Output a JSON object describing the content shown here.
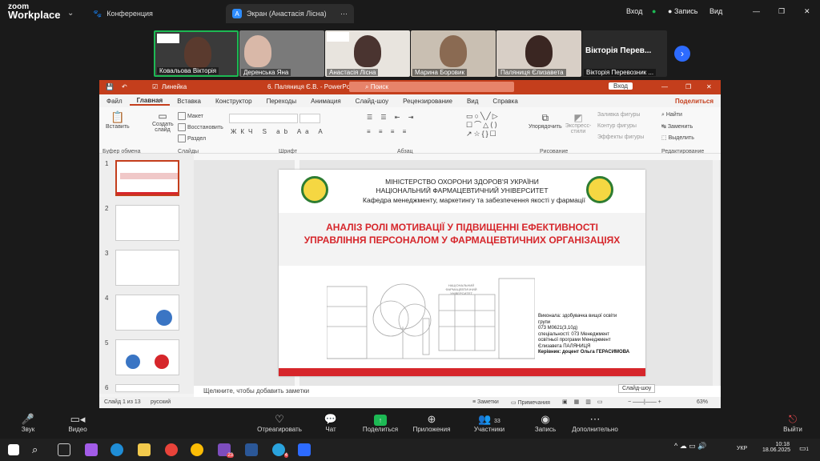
{
  "app": {
    "brand_line1": "zoom",
    "brand_line2": "Workplace"
  },
  "tabs": [
    {
      "label": "Конференция"
    },
    {
      "label": "Экран (Анастасія Лісна)",
      "icon_letter": "A"
    }
  ],
  "top_actions": {
    "login": "Вход",
    "record": "Запись",
    "view": "Вид"
  },
  "participants": [
    {
      "name": "Ковальова Вікторія"
    },
    {
      "name": "Деренська Яна"
    },
    {
      "name": "Анастасія Лісна"
    },
    {
      "name": "Марина Боровик"
    },
    {
      "name": "Паляниця Єлизавета"
    },
    {
      "name": "Вікторія Перевозник ...",
      "big_label": "Вікторія Перев..."
    }
  ],
  "ppt": {
    "doc_title": "6. Паляниця Є.В. - PowerPoint",
    "quick_label": "Линейка",
    "search_placeholder": "Поиск",
    "login": "Вход",
    "share": "Поделиться",
    "menu": [
      "Файл",
      "Главная",
      "Вставка",
      "Конструктор",
      "Переходы",
      "Анимация",
      "Слайд-шоу",
      "Рецензирование",
      "Вид",
      "Справка"
    ],
    "ribbon": {
      "paste": "Вставить",
      "new_slide": "Создать слайд",
      "layout": "Макет",
      "reset": "Восстановить",
      "section": "Раздел",
      "arrange": "Упорядочить",
      "styles": "Экспресс-стили",
      "fill": "Заливка фигуры",
      "outline": "Контур фигуры",
      "effects": "Эффекты фигуры",
      "find": "Найти",
      "replace": "Заменить",
      "select": "Выделить",
      "groups": [
        "Буфер обмена",
        "Слайды",
        "Шрифт",
        "Абзац",
        "Рисование",
        "Редактирование"
      ]
    },
    "slide_numbers": [
      "1",
      "2",
      "3",
      "4",
      "5",
      "6"
    ],
    "slide": {
      "ministry": "МІНІСТЕРСТВО ОХОРОНИ ЗДОРОВ'Я УКРАЇНИ",
      "university": "НАЦІОНАЛЬНИЙ ФАРМАЦЕВТИЧНИЙ УНІВЕРСИТЕТ",
      "department": "Кафедра менеджменту, маркетингу та забезпечення якості у фармації",
      "title": "АНАЛІЗ РОЛІ МОТИВАЦІЇ У ПІДВИЩЕННІ ЕФЕКТИВНОСТІ УПРАВЛІННЯ ПЕРСОНАЛОМ У ФАРМАЦЕВТИЧНИХ ОРГАНІЗАЦІЯХ",
      "credits": [
        "Виконала: здобувачка вищої освіти",
        "групи",
        "073 М0621(3,10д)",
        "спеціальності: 073 Менеджмент",
        "освітньої програми Менеджмент",
        "Єлизавета ПАЛЯНИЦЯ",
        "Керівник: доцент Ольга ГЕРАСИМОВА"
      ],
      "building_sign": "НАЦІОНАЛЬНИЙ ФАРМАЦЕВТИЧНИЙ УНІВЕРСИТЕТ"
    },
    "notes_placeholder": "Щелкните, чтобы добавить заметки",
    "status": {
      "slide_info": "Слайд 1 из 13",
      "language": "русский",
      "notes": "Заметки",
      "comments": "Примечания",
      "zoom": "63%",
      "slideshow_tip": "Слайд-шоу"
    }
  },
  "toolbar": [
    {
      "label": "Звук",
      "icon": "mic-muted-icon"
    },
    {
      "label": "Видео",
      "icon": "video-icon"
    },
    {
      "label": "Отреагировать",
      "icon": "heart-icon"
    },
    {
      "label": "Чат",
      "icon": "chat-icon"
    },
    {
      "label": "Поделиться",
      "icon": "share-icon"
    },
    {
      "label": "Приложения",
      "icon": "apps-icon"
    },
    {
      "label": "Участники",
      "icon": "participants-icon",
      "count": "33"
    },
    {
      "label": "Запись",
      "icon": "record-icon"
    },
    {
      "label": "Дополнительно",
      "icon": "more-icon"
    },
    {
      "label": "Выйти",
      "icon": "leave-icon"
    }
  ],
  "taskbar": {
    "time": "10:18",
    "date": "18.06.2025",
    "lang": "УКР",
    "badge_viber": "23",
    "badge_chat": "4",
    "notif": "1"
  },
  "colors": {
    "ppt_red": "#c43e1c",
    "slide_red": "#d6262b",
    "zoom_blue": "#2d6bff",
    "share_green": "#1db954"
  }
}
